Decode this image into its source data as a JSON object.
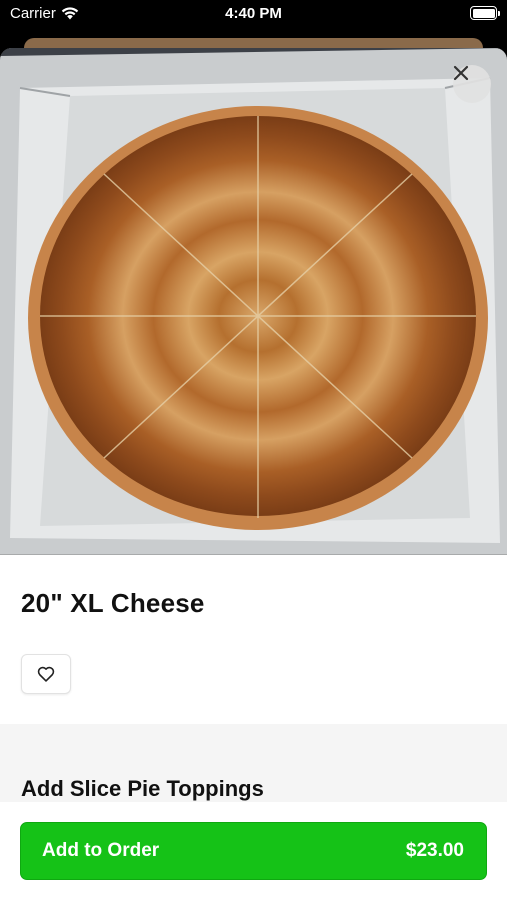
{
  "status_bar": {
    "carrier": "Carrier",
    "time": "4:40 PM"
  },
  "item": {
    "title": "20\" XL Cheese",
    "image_icon": "pizza-photo"
  },
  "close_icon": "close-icon",
  "favorite_icon": "heart-icon",
  "modifiers": {
    "section_title": "Add Slice Pie Toppings"
  },
  "footer": {
    "button_label": "Add to Order",
    "price": "$23.00",
    "accent": "#15c217"
  }
}
